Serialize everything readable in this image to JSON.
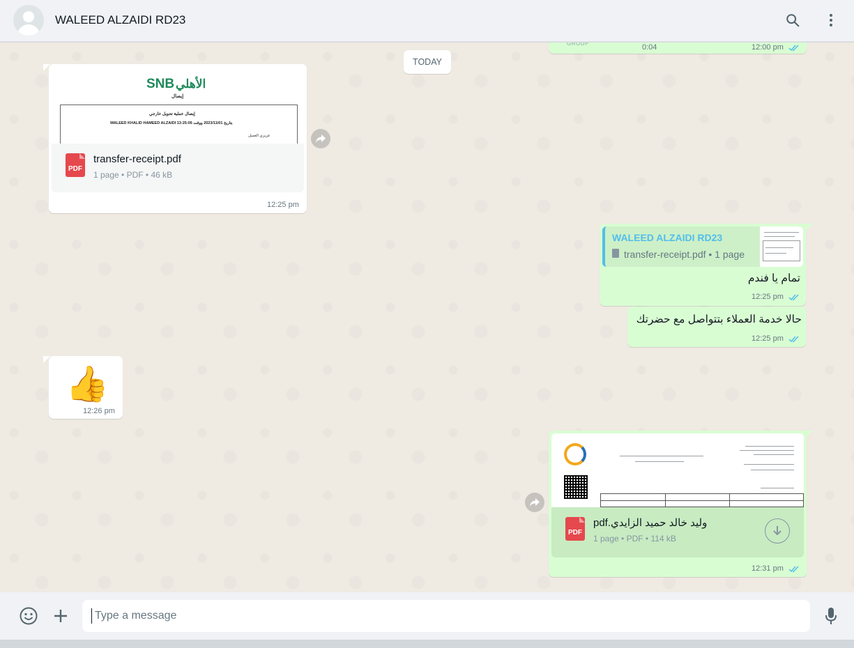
{
  "header": {
    "chat_name": "WALEED ALZAIDI RD23",
    "icons": [
      "avatar",
      "search-icon",
      "menu-icon"
    ]
  },
  "date_divider": "TODAY",
  "messages": [
    {
      "direction": "outgoing",
      "partial": true,
      "duration": "0:04",
      "time": "12:00 pm",
      "status": "read"
    },
    {
      "direction": "incoming",
      "type": "document",
      "preview": {
        "brand_ar": "الأهلي",
        "brand_en": "SNB",
        "subtitle": "إيصال",
        "heading": "إيصال عملية تحويل خارجي",
        "detail": "WALEED KHALID HAMEED ALZAIDI بتاريخ 2023/11/01 ووقت 13:25:06",
        "footer": "عزيزي العميل"
      },
      "file_name": "transfer-receipt.pdf",
      "pages": "1 page",
      "file_type": "PDF",
      "size": "46 kB",
      "time": "12:25 pm"
    },
    {
      "direction": "outgoing",
      "type": "reply",
      "quoted_author": "WALEED ALZAIDI RD23",
      "quoted_file": "transfer-receipt.pdf • 1 page",
      "text": "تمام يا فندم",
      "time": "12:25 pm",
      "status": "read"
    },
    {
      "direction": "outgoing",
      "type": "text",
      "text": "حالا خدمة العملاء بتتواصل مع حضرتك",
      "time": "12:25 pm",
      "status": "read"
    },
    {
      "direction": "incoming",
      "type": "emoji",
      "emoji": "👍",
      "time": "12:26 pm"
    },
    {
      "direction": "outgoing",
      "type": "document",
      "file_name": "وليد خالد حميد الزايدي.pdf",
      "pages": "1 page",
      "file_type": "PDF",
      "size": "114 kB",
      "time": "12:31 pm",
      "status": "read"
    }
  ],
  "composer": {
    "placeholder": "Type a message"
  },
  "colors": {
    "outgoing_bubble": "#d9fdd3",
    "incoming_bubble": "#ffffff",
    "read_ticks": "#53bdeb",
    "pdf_badge": "#e5484d",
    "quote_accent": "#53bdeb"
  }
}
